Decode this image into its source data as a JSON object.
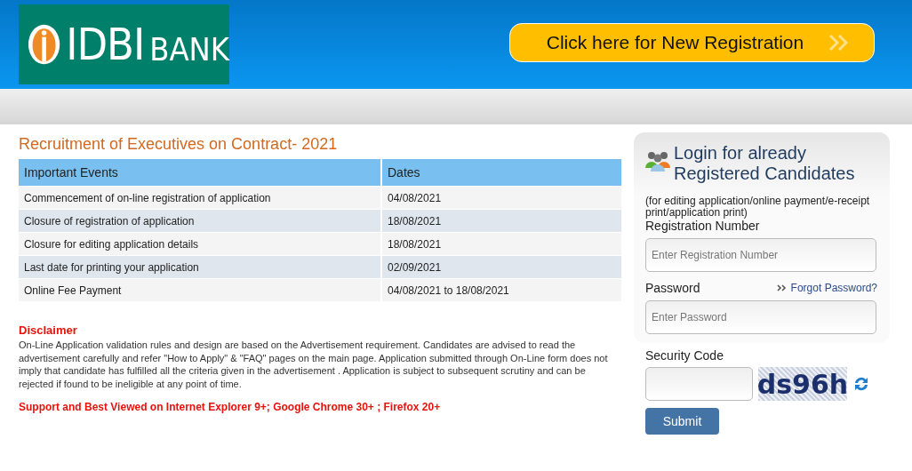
{
  "header": {
    "logo_text": "IDBI",
    "logo_text_2": "BANK",
    "registration_button": "Click here for New Registration"
  },
  "main": {
    "title": "Recruitment of Executives on Contract- 2021",
    "table": {
      "columns": [
        "Important Events",
        "Dates"
      ],
      "rows": [
        [
          "Commencement of on-line registration of application",
          "04/08/2021"
        ],
        [
          "Closure of registration of application",
          "18/08/2021"
        ],
        [
          "Closure for editing application details",
          "18/08/2021"
        ],
        [
          "Last date for printing your application",
          "02/09/2021"
        ],
        [
          "Online Fee Payment",
          "04/08/2021 to 18/08/2021"
        ]
      ]
    },
    "disclaimer_title": "Disclaimer",
    "disclaimer_text": "On-Line Application validation rules and design are based on the Advertisement requirement. Candidates are advised to read the advertisement carefully and refer \"How to Apply\" & \"FAQ\" pages on the main page. Application submitted through On-Line form does not imply that candidate has fulfilled all the criteria given in the advertisement . Application is subject to subsequent scrutiny and can be rejected if found to be ineligible at any point of time.",
    "browser_note": "Support and Best Viewed on Internet Explorer 9+; Google Chrome 30+ ; Firefox 20+"
  },
  "login": {
    "title_line_1": "Login for already",
    "title_line_2": "Registered Candidates",
    "subtitle": "(for editing application/online payment/e-receipt print/application print)",
    "registration_label": "Registration Number",
    "registration_placeholder": "Enter Registration Number",
    "password_label": "Password",
    "forgot_link": "Forgot Password?",
    "password_placeholder": "Enter Password",
    "security_label": "Security Code",
    "captcha_text": "ds96h",
    "submit": "Submit"
  }
}
